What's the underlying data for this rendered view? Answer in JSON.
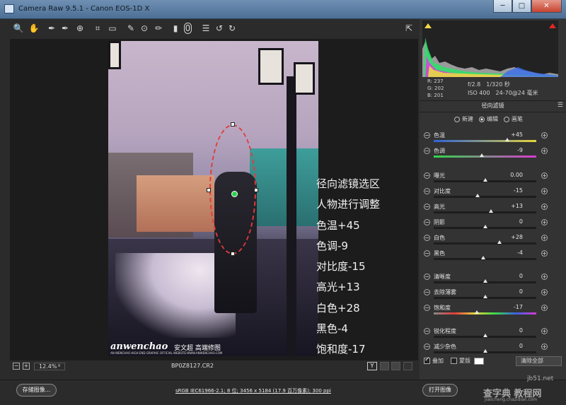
{
  "window": {
    "title": "Camera Raw 9.5.1 -  Canon EOS-1D X",
    "minimize": "─",
    "maximize": "□",
    "close": "✕"
  },
  "toolbar": {
    "tools": [
      {
        "name": "zoom-icon",
        "glyph": "🔍"
      },
      {
        "name": "hand-icon",
        "glyph": "✋"
      },
      {
        "name": "white-balance-icon",
        "glyph": "✒"
      },
      {
        "name": "color-sampler-icon",
        "glyph": "✒"
      },
      {
        "name": "targeted-adjust-icon",
        "glyph": "⊕"
      },
      {
        "name": "crop-icon",
        "glyph": "⌗"
      },
      {
        "name": "straighten-icon",
        "glyph": "▭"
      },
      {
        "name": "spot-removal-icon",
        "glyph": "✎"
      },
      {
        "name": "red-eye-icon",
        "glyph": "⊙"
      },
      {
        "name": "adjustment-brush-icon",
        "glyph": "✏"
      },
      {
        "name": "graduated-filter-icon",
        "glyph": "▮"
      },
      {
        "name": "radial-filter-icon",
        "glyph": "0"
      },
      {
        "name": "preferences-icon",
        "glyph": "☰"
      },
      {
        "name": "rotate-left-icon",
        "glyph": "↺"
      },
      {
        "name": "rotate-right-icon",
        "glyph": "↻"
      }
    ],
    "fullscreen_icon": "⇱"
  },
  "photo": {
    "watermark_brand": "anwenchao",
    "watermark_cn": "安文超 高端修图",
    "watermark_sub": "AN WENCHAO HIGH END GRAPHIC OFFICIAL WEBSITE:WWW.ANWENCHAO.COM"
  },
  "annotation": [
    "径向滤镜选区",
    "人物进行调整",
    "色温+45",
    "色调-9",
    "对比度-15",
    "高光+13",
    "白色+28",
    "黑色-4",
    "饱和度-17"
  ],
  "status": {
    "zoom_out": "−",
    "zoom_in": "+",
    "zoom": "12.4%",
    "zoom_dropdown": "∨",
    "filename": "BP0Z8127.CR2",
    "y_button": "Y"
  },
  "histogram": {
    "r_label": "R:",
    "g_label": "G:",
    "b_label": "B:",
    "r": "237",
    "g": "202",
    "b": "201",
    "aperture": "f/2.8",
    "shutter": "1/320 秒",
    "iso": "ISO 400",
    "lens": "24-70@24 毫米"
  },
  "radial_filter": {
    "title": "径向滤镜",
    "modes": [
      {
        "label": "新建",
        "selected": false
      },
      {
        "label": "编辑",
        "selected": true
      },
      {
        "label": "画笔",
        "selected": false
      }
    ],
    "sliders": [
      {
        "label": "色温",
        "value": "+45",
        "pos": 0.72,
        "track": "temp"
      },
      {
        "label": "色调",
        "value": "-9",
        "pos": 0.47,
        "track": "tint"
      },
      {
        "label": "曝光",
        "value": "0.00",
        "pos": 0.5,
        "track": "plain"
      },
      {
        "label": "对比度",
        "value": "-15",
        "pos": 0.43,
        "track": "plain"
      },
      {
        "label": "高光",
        "value": "+13",
        "pos": 0.56,
        "track": "plain"
      },
      {
        "label": "阴影",
        "value": "0",
        "pos": 0.5,
        "track": "plain"
      },
      {
        "label": "白色",
        "value": "+28",
        "pos": 0.64,
        "track": "plain"
      },
      {
        "label": "黑色",
        "value": "-4",
        "pos": 0.48,
        "track": "plain"
      },
      {
        "label": "清晰度",
        "value": "0",
        "pos": 0.5,
        "track": "plain"
      },
      {
        "label": "去除薄雾",
        "value": "0",
        "pos": 0.5,
        "track": "plain"
      },
      {
        "label": "饱和度",
        "value": "-17",
        "pos": 0.42,
        "track": "sat"
      },
      {
        "label": "锐化程度",
        "value": "0",
        "pos": 0.5,
        "track": "plain"
      },
      {
        "label": "减少杂色",
        "value": "0",
        "pos": 0.5,
        "track": "plain"
      }
    ],
    "overlay_label": "叠加",
    "mask_label": "蒙版",
    "clear_all": "清除全部"
  },
  "footer": {
    "save_button": "存储图像...",
    "workflow_link": "sRGB IEC61966-2.1; 8 位; 3456 x 5184 (17.9 百万像素); 300 ppi",
    "open_button": "打开图像"
  },
  "site_watermark": {
    "url": "jb51.net",
    "cn": "查字典 教程网",
    "sub": "jiaocheng.chazidian.com"
  },
  "colors": {
    "accent_clip_shadow": "#f0d64a",
    "accent_clip_highlight": "#e02727",
    "radial_outline": "#e23b3b",
    "pin": "#2bd24b"
  }
}
